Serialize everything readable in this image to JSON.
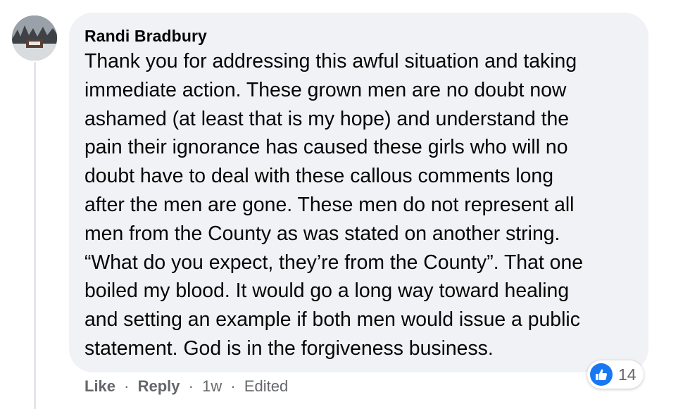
{
  "comment": {
    "author": "Randi Bradbury",
    "text_lines": [
      "Thank you for addressing this awful situation and taking",
      "immediate action. These grown men are no doubt now",
      "ashamed (at least that is my hope) and understand the",
      "pain their ignorance has caused these girls who will no",
      "doubt have to deal with these callous comments long",
      "after the men are gone. These men do not represent all",
      "men from the County as was stated on another string.",
      "“What do you expect, they’re from the County”. That one",
      "boiled my blood. It would go a long way toward healing",
      "and setting an example if both men would issue a public",
      "statement. God is in the forgiveness business."
    ],
    "reaction_icon": "like-thumb-icon",
    "reaction_count": "14"
  },
  "actions": {
    "like_label": "Like",
    "reply_label": "Reply",
    "separator": "·",
    "timestamp": "1w",
    "edited_label": "Edited"
  },
  "colors": {
    "bubble": "#f0f2f5",
    "text": "#050505",
    "meta": "#65676b",
    "like_blue": "#1877f2"
  }
}
